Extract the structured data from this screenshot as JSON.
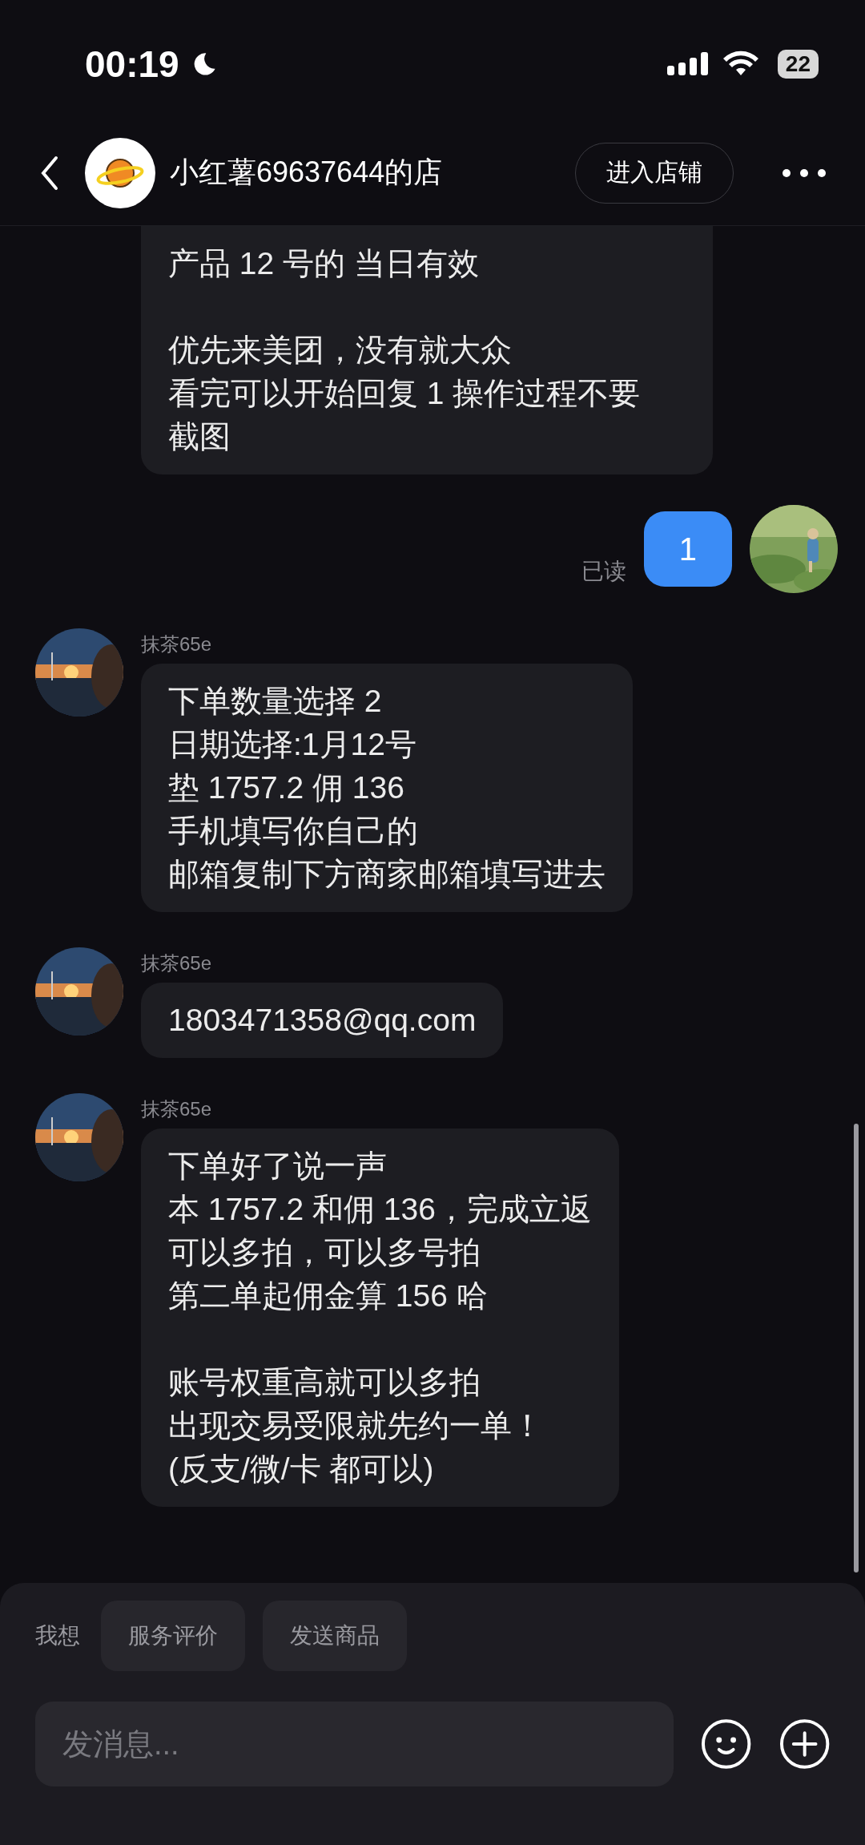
{
  "status_bar": {
    "time": "00:19",
    "battery": "22"
  },
  "header": {
    "title": "小红薯69637644的店",
    "shop_button": "进入店铺"
  },
  "messages": [
    {
      "kind": "received",
      "continued": true,
      "paragraphs": [
        [
          "产品 12 号的 当日有效"
        ],
        [
          "优先来美团，没有就大众",
          "看完可以开始回复 1 操作过程不要截图"
        ]
      ]
    },
    {
      "kind": "sent",
      "text": "1",
      "status": "已读"
    },
    {
      "kind": "received",
      "name": "抹茶65e",
      "paragraphs": [
        [
          "下单数量选择 2",
          "日期选择:1月12号",
          "垫 1757.2 佣 136",
          "手机填写你自己的",
          "邮箱复制下方商家邮箱填写进去"
        ]
      ]
    },
    {
      "kind": "received",
      "name": "抹茶65e",
      "paragraphs": [
        [
          "1803471358@qq.com"
        ]
      ]
    },
    {
      "kind": "received",
      "name": "抹茶65e",
      "paragraphs": [
        [
          "下单好了说一声",
          "本 1757.2 和佣 136，完成立返",
          "可以多拍，可以多号拍",
          "第二单起佣金算 156 哈"
        ],
        [
          "账号权重高就可以多拍",
          "出现交易受限就先约一单！",
          "(反支/微/卡 都可以)"
        ]
      ]
    }
  ],
  "composer": {
    "prompt_label": "我想",
    "quick_actions": [
      "服务评价",
      "发送商品"
    ],
    "placeholder": "发消息..."
  }
}
